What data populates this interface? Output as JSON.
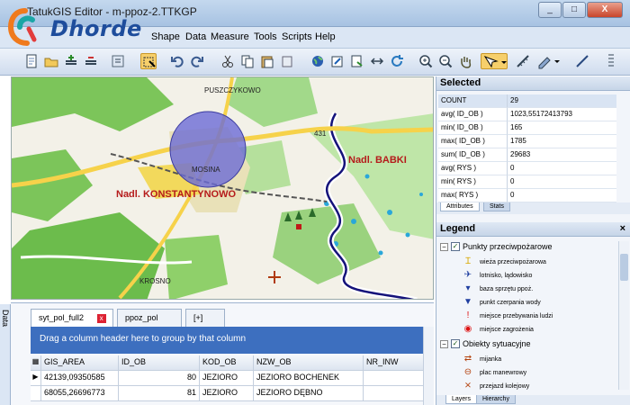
{
  "window": {
    "title": "TatukGIS Editor - m-ppoz-2.TTKGP",
    "controls": [
      "_",
      "□",
      "X"
    ]
  },
  "watermark": {
    "text": "Dhorde"
  },
  "menu": {
    "items": [
      "Shape",
      "Data",
      "Measure",
      "Tools",
      "Scripts",
      "Help"
    ]
  },
  "map": {
    "labels": {
      "north": "PUSZCZYKOWO",
      "center": "MOSINA",
      "south": "KROSNO",
      "babki": "Nadl. BABKI",
      "konst": "Nadl. KONSTANTYNOWO",
      "road": "431"
    },
    "colors": {
      "forest": "#6cc04a",
      "river": "#16127a",
      "water": "#2aa7d9",
      "label": "#b51b1b"
    }
  },
  "data_panel": {
    "side_tab": "Data",
    "tabs": [
      "syt_pol_full2",
      "ppoz_pol",
      "[+]"
    ],
    "group_hint": "Drag a column header here to group by that column",
    "columns": [
      "GIS_AREA",
      "ID_OB",
      "KOD_OB",
      "NZW_OB",
      "NR_INW"
    ],
    "rows": [
      [
        "42139,09350585",
        "80",
        "JEZIORO",
        "JEZIORO BOCHENEK",
        ""
      ],
      [
        "68055,26696773",
        "81",
        "JEZIORO",
        "JEZIORO DĘBNO",
        ""
      ]
    ]
  },
  "selected_panel": {
    "title": "Selected",
    "rows": [
      [
        "COUNT",
        "29"
      ],
      [
        "avg( ID_OB )",
        "1023,55172413793"
      ],
      [
        "min( ID_OB )",
        "165"
      ],
      [
        "max( ID_OB )",
        "1785"
      ],
      [
        "sum( ID_OB )",
        "29683"
      ],
      [
        "avg( RYS )",
        "0"
      ],
      [
        "min( RYS )",
        "0"
      ],
      [
        "max( RYS )",
        "0"
      ]
    ],
    "tabs": [
      "Attributes",
      "Stats"
    ]
  },
  "legend_panel": {
    "title": "Legend",
    "groups": [
      {
        "name": "Punkty przeciwpożarowe",
        "items": [
          "wieża przeciwpożarowa",
          "lotnisko, lądowisko",
          "baza sprzętu ppoż.",
          "punkt czerpania wody",
          "miejsce przebywania ludzi",
          "miejsce zagrożenia"
        ]
      },
      {
        "name": "Obiekty sytuacyjne",
        "items": [
          "mijanka",
          "plac manewrowy",
          "przejazd kolejowy"
        ]
      }
    ],
    "tabs": [
      "Layers",
      "Hierarchy"
    ]
  }
}
